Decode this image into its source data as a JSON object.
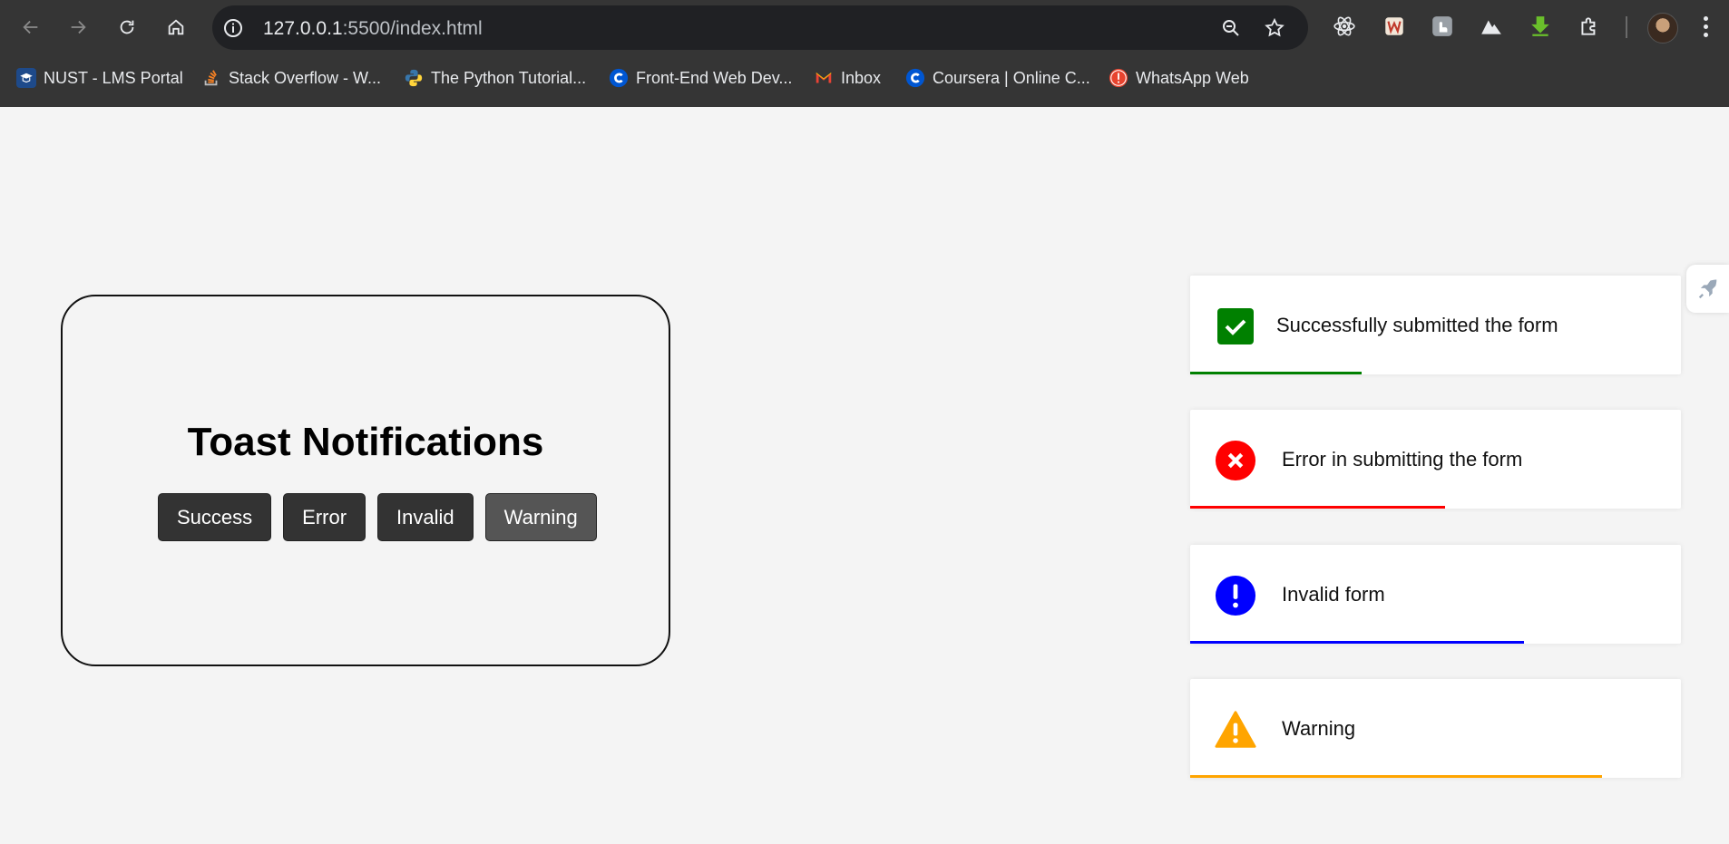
{
  "browser": {
    "url_host": "127.0.0.1",
    "url_rest": ":5500/index.html",
    "bookmarks": [
      {
        "label": "NUST - LMS Portal",
        "icon": "nust-icon"
      },
      {
        "label": "Stack Overflow - W...",
        "icon": "stackoverflow-icon"
      },
      {
        "label": "The Python Tutorial...",
        "icon": "python-icon"
      },
      {
        "label": "Front-End Web Dev...",
        "icon": "coursera-icon"
      },
      {
        "label": "Inbox",
        "icon": "gmail-icon"
      },
      {
        "label": "Coursera | Online C...",
        "icon": "coursera-icon"
      },
      {
        "label": "WhatsApp Web",
        "icon": "whatsapp-alert-icon"
      }
    ]
  },
  "page": {
    "title": "Toast Notifications",
    "buttons": {
      "success": "Success",
      "error": "Error",
      "invalid": "Invalid",
      "warning": "Warning"
    }
  },
  "toasts": [
    {
      "type": "success",
      "message": "Successfully submitted the form",
      "color": "#008000",
      "progress": 0.35
    },
    {
      "type": "error",
      "message": "Error in submitting the form",
      "color": "#ff0000",
      "progress": 0.52
    },
    {
      "type": "invalid",
      "message": "Invalid form",
      "color": "#0000ff",
      "progress": 0.68
    },
    {
      "type": "warning",
      "message": "Warning",
      "color": "#ffa500",
      "progress": 0.84
    }
  ]
}
